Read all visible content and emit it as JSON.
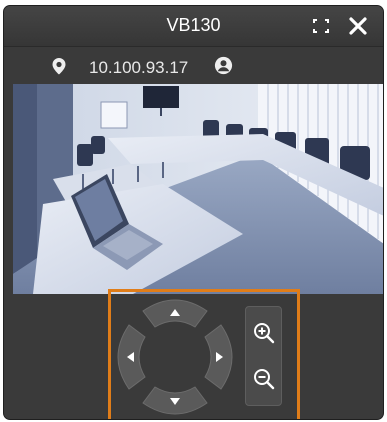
{
  "window": {
    "title": "VB130"
  },
  "info": {
    "ip_address": "10.100.93.17"
  },
  "icons": {
    "fullscreen": "fullscreen-icon",
    "close": "close-icon",
    "location": "map-pin-icon",
    "user": "user-icon",
    "zoom_in": "zoom-in-icon",
    "zoom_out": "zoom-out-icon"
  },
  "colors": {
    "window_bg": "#3a3a3a",
    "highlight_border": "#e07d19",
    "button_fill": "#595959",
    "text": "#ffffff"
  }
}
